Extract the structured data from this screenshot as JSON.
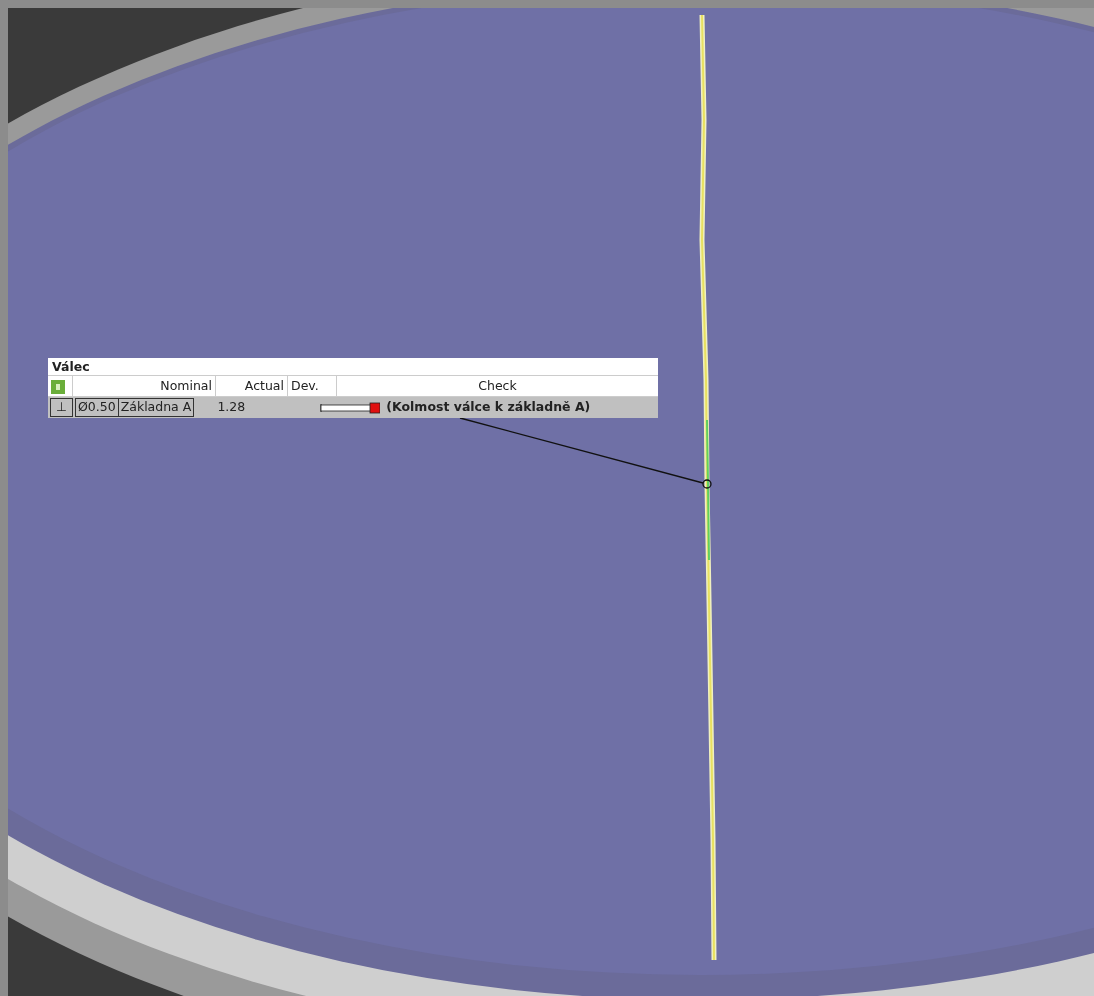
{
  "label": {
    "title": "Válec",
    "columns": [
      {
        "label": "Nominal"
      },
      {
        "label": "Actual"
      },
      {
        "label": "Dev."
      },
      {
        "label": "Check"
      }
    ],
    "row": {
      "symbol": "⊥",
      "tolerance": "Ø0.50",
      "datum": "Základna A",
      "actual": "1.28",
      "check": "(Kolmost válce k základně A)"
    }
  }
}
